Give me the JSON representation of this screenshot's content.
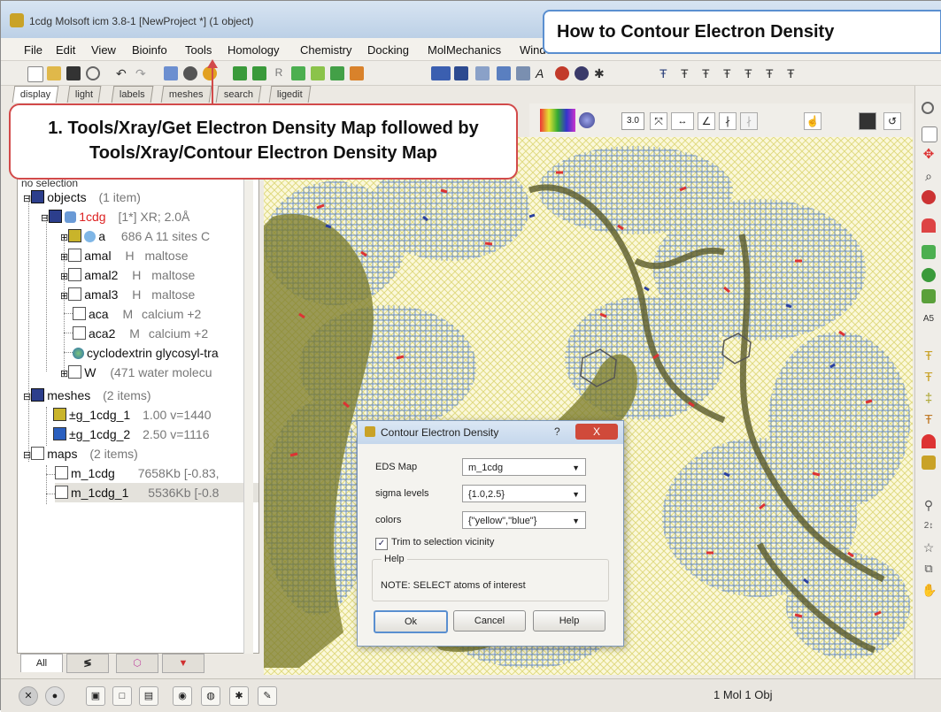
{
  "window": {
    "title": "1cdg Molsoft icm 3.8-1  [NewProject *] (1 object)"
  },
  "menu": [
    "File",
    "Edit",
    "View",
    "Bioinfo",
    "Tools",
    "Homology",
    "Chemistry",
    "Docking",
    "MolMechanics",
    "Windows"
  ],
  "tabs": [
    "display",
    "light",
    "labels",
    "meshes",
    "search",
    "ligedit"
  ],
  "callouts": {
    "step1": "1. Tools/Xray/Get Electron Density Map followed by Tools/Xray/Contour Electron Density Map",
    "title": "How to Contour Electron Density"
  },
  "panel": {
    "header": "no selection",
    "objects": {
      "label": "objects",
      "count": "(1 item)"
    },
    "obj_1cdg": {
      "name": "1cdg",
      "info": "[1*] XR; 2.0Å"
    },
    "molecules": [
      {
        "name": "a",
        "type": "686 A",
        "desc": "11 sites C"
      },
      {
        "name": "amal",
        "type": "H",
        "desc": "maltose"
      },
      {
        "name": "amal2",
        "type": "H",
        "desc": "maltose"
      },
      {
        "name": "amal3",
        "type": "H",
        "desc": "maltose"
      },
      {
        "name": "aca",
        "type": "M",
        "desc": "calcium +2"
      },
      {
        "name": "aca2",
        "type": "M",
        "desc": "calcium +2"
      },
      {
        "name": "cyclodextrin glycosyl-tra",
        "type": "",
        "desc": ""
      },
      {
        "name": "W",
        "type": "",
        "desc": "(471 water molecu"
      }
    ],
    "meshes": {
      "label": "meshes",
      "count": "(2 items)"
    },
    "mesh_items": [
      {
        "name": "g_1cdg_1",
        "info": "1.00 v=1440"
      },
      {
        "name": "g_1cdg_2",
        "info": "2.50 v=1116"
      }
    ],
    "maps": {
      "label": "maps",
      "count": "(2 items)"
    },
    "map_items": [
      {
        "name": "m_1cdg",
        "info": "7658Kb [-0.83,"
      },
      {
        "name": "m_1cdg_1",
        "info": "5536Kb [-0.8"
      }
    ],
    "bottom_tabs": [
      "All"
    ]
  },
  "viewer": {
    "zoom_label": "3.0"
  },
  "dialog": {
    "title": "Contour Electron Density",
    "help_symbol": "?",
    "close_symbol": "X",
    "eds_map_label": "EDS Map",
    "eds_map_value": "m_1cdg",
    "sigma_label": "sigma levels",
    "sigma_value": "{1.0,2.5}",
    "colors_label": "colors",
    "colors_value": "{\"yellow\",\"blue\"}",
    "trim_label": "Trim to selection vicinity",
    "trim_checked": true,
    "help_group": "Help",
    "note": "NOTE: SELECT atoms of interest",
    "ok": "Ok",
    "cancel": "Cancel",
    "help_btn": "Help"
  },
  "status": {
    "text": "1 Mol 1 Obj"
  },
  "colors": {
    "callout_red": "#d24a4a",
    "callout_blue": "#5a8fd0",
    "mesh_yellow": "#c9c23a",
    "mesh_blue": "#4a78c8"
  }
}
